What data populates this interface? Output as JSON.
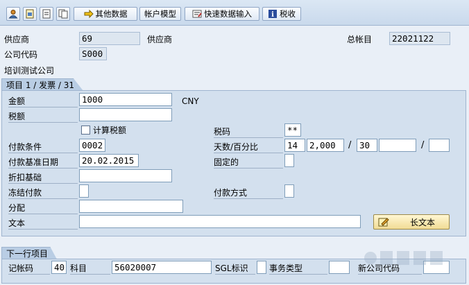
{
  "toolbar": {
    "other_data_label": "其他数据",
    "account_model_label": "帐户模型",
    "fast_entry_label": "快速数据输入",
    "tax_label": "税收"
  },
  "header": {
    "vendor_label": "供应商",
    "vendor_value": "69",
    "vendor_name_label": "供应商",
    "gl_label": "总帐目",
    "gl_value": "22021122",
    "company_code_label": "公司代码",
    "company_code_value": "S000",
    "company_name": "培训测试公司"
  },
  "item_tab": {
    "title": "项目 1 / 发票 / 31"
  },
  "item": {
    "amount_label": "金额",
    "amount_value": "1000",
    "currency": "CNY",
    "tax_amount_label": "税额",
    "tax_amount_value": "",
    "calc_tax_label": "计算税额",
    "tax_code_label": "税码",
    "tax_code_value": "**",
    "payment_terms_label": "付款条件",
    "payment_terms_value": "0002",
    "days_pct_label": "天数/百分比",
    "days1": "14",
    "pct1": "2,000",
    "days2": "30",
    "pct2": "",
    "days3": "",
    "sep1": "/",
    "sep2": "/",
    "baseline_date_label": "付款基准日期",
    "baseline_date_value": "20.02.2015",
    "fixed_label": "固定的",
    "discount_base_label": "折扣基础",
    "discount_base_value": "",
    "payment_block_label": "冻结付款",
    "payment_method_label": "付款方式",
    "assignment_label": "分配",
    "assignment_value": "",
    "text_label": "文本",
    "text_value": "",
    "long_text_button": "长文本"
  },
  "next_tab": {
    "title": "下一行项目"
  },
  "next": {
    "posting_key_label": "记帐码",
    "posting_key_value": "40",
    "account_label": "科目",
    "account_value": "56020007",
    "sgl_label": "SGL标识",
    "trans_type_label": "事务类型",
    "new_cc_label": "新公司代码"
  }
}
